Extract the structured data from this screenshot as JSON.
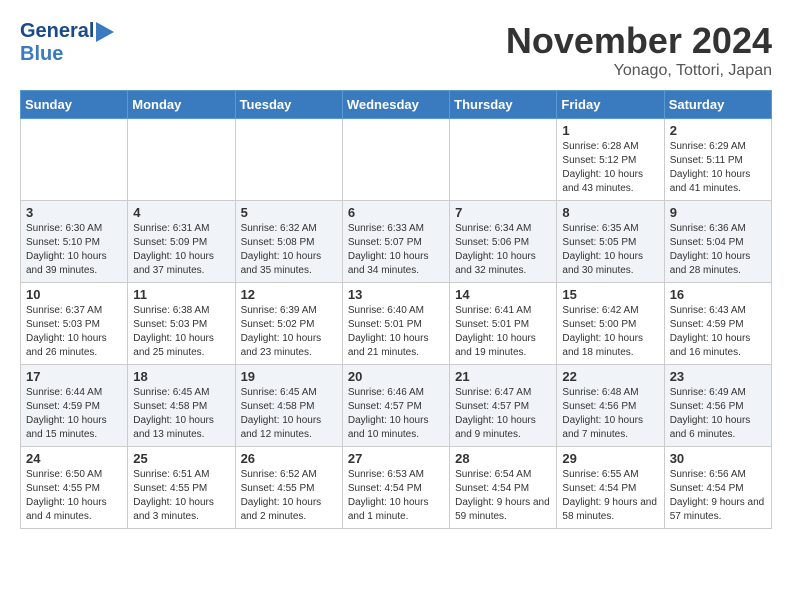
{
  "header": {
    "logo_general": "General",
    "logo_blue": "Blue",
    "month_title": "November 2024",
    "location": "Yonago, Tottori, Japan"
  },
  "weekdays": [
    "Sunday",
    "Monday",
    "Tuesday",
    "Wednesday",
    "Thursday",
    "Friday",
    "Saturday"
  ],
  "weeks": [
    [
      {
        "day": "",
        "info": ""
      },
      {
        "day": "",
        "info": ""
      },
      {
        "day": "",
        "info": ""
      },
      {
        "day": "",
        "info": ""
      },
      {
        "day": "",
        "info": ""
      },
      {
        "day": "1",
        "info": "Sunrise: 6:28 AM\nSunset: 5:12 PM\nDaylight: 10 hours and 43 minutes."
      },
      {
        "day": "2",
        "info": "Sunrise: 6:29 AM\nSunset: 5:11 PM\nDaylight: 10 hours and 41 minutes."
      }
    ],
    [
      {
        "day": "3",
        "info": "Sunrise: 6:30 AM\nSunset: 5:10 PM\nDaylight: 10 hours and 39 minutes."
      },
      {
        "day": "4",
        "info": "Sunrise: 6:31 AM\nSunset: 5:09 PM\nDaylight: 10 hours and 37 minutes."
      },
      {
        "day": "5",
        "info": "Sunrise: 6:32 AM\nSunset: 5:08 PM\nDaylight: 10 hours and 35 minutes."
      },
      {
        "day": "6",
        "info": "Sunrise: 6:33 AM\nSunset: 5:07 PM\nDaylight: 10 hours and 34 minutes."
      },
      {
        "day": "7",
        "info": "Sunrise: 6:34 AM\nSunset: 5:06 PM\nDaylight: 10 hours and 32 minutes."
      },
      {
        "day": "8",
        "info": "Sunrise: 6:35 AM\nSunset: 5:05 PM\nDaylight: 10 hours and 30 minutes."
      },
      {
        "day": "9",
        "info": "Sunrise: 6:36 AM\nSunset: 5:04 PM\nDaylight: 10 hours and 28 minutes."
      }
    ],
    [
      {
        "day": "10",
        "info": "Sunrise: 6:37 AM\nSunset: 5:03 PM\nDaylight: 10 hours and 26 minutes."
      },
      {
        "day": "11",
        "info": "Sunrise: 6:38 AM\nSunset: 5:03 PM\nDaylight: 10 hours and 25 minutes."
      },
      {
        "day": "12",
        "info": "Sunrise: 6:39 AM\nSunset: 5:02 PM\nDaylight: 10 hours and 23 minutes."
      },
      {
        "day": "13",
        "info": "Sunrise: 6:40 AM\nSunset: 5:01 PM\nDaylight: 10 hours and 21 minutes."
      },
      {
        "day": "14",
        "info": "Sunrise: 6:41 AM\nSunset: 5:01 PM\nDaylight: 10 hours and 19 minutes."
      },
      {
        "day": "15",
        "info": "Sunrise: 6:42 AM\nSunset: 5:00 PM\nDaylight: 10 hours and 18 minutes."
      },
      {
        "day": "16",
        "info": "Sunrise: 6:43 AM\nSunset: 4:59 PM\nDaylight: 10 hours and 16 minutes."
      }
    ],
    [
      {
        "day": "17",
        "info": "Sunrise: 6:44 AM\nSunset: 4:59 PM\nDaylight: 10 hours and 15 minutes."
      },
      {
        "day": "18",
        "info": "Sunrise: 6:45 AM\nSunset: 4:58 PM\nDaylight: 10 hours and 13 minutes."
      },
      {
        "day": "19",
        "info": "Sunrise: 6:45 AM\nSunset: 4:58 PM\nDaylight: 10 hours and 12 minutes."
      },
      {
        "day": "20",
        "info": "Sunrise: 6:46 AM\nSunset: 4:57 PM\nDaylight: 10 hours and 10 minutes."
      },
      {
        "day": "21",
        "info": "Sunrise: 6:47 AM\nSunset: 4:57 PM\nDaylight: 10 hours and 9 minutes."
      },
      {
        "day": "22",
        "info": "Sunrise: 6:48 AM\nSunset: 4:56 PM\nDaylight: 10 hours and 7 minutes."
      },
      {
        "day": "23",
        "info": "Sunrise: 6:49 AM\nSunset: 4:56 PM\nDaylight: 10 hours and 6 minutes."
      }
    ],
    [
      {
        "day": "24",
        "info": "Sunrise: 6:50 AM\nSunset: 4:55 PM\nDaylight: 10 hours and 4 minutes."
      },
      {
        "day": "25",
        "info": "Sunrise: 6:51 AM\nSunset: 4:55 PM\nDaylight: 10 hours and 3 minutes."
      },
      {
        "day": "26",
        "info": "Sunrise: 6:52 AM\nSunset: 4:55 PM\nDaylight: 10 hours and 2 minutes."
      },
      {
        "day": "27",
        "info": "Sunrise: 6:53 AM\nSunset: 4:54 PM\nDaylight: 10 hours and 1 minute."
      },
      {
        "day": "28",
        "info": "Sunrise: 6:54 AM\nSunset: 4:54 PM\nDaylight: 9 hours and 59 minutes."
      },
      {
        "day": "29",
        "info": "Sunrise: 6:55 AM\nSunset: 4:54 PM\nDaylight: 9 hours and 58 minutes."
      },
      {
        "day": "30",
        "info": "Sunrise: 6:56 AM\nSunset: 4:54 PM\nDaylight: 9 hours and 57 minutes."
      }
    ]
  ]
}
